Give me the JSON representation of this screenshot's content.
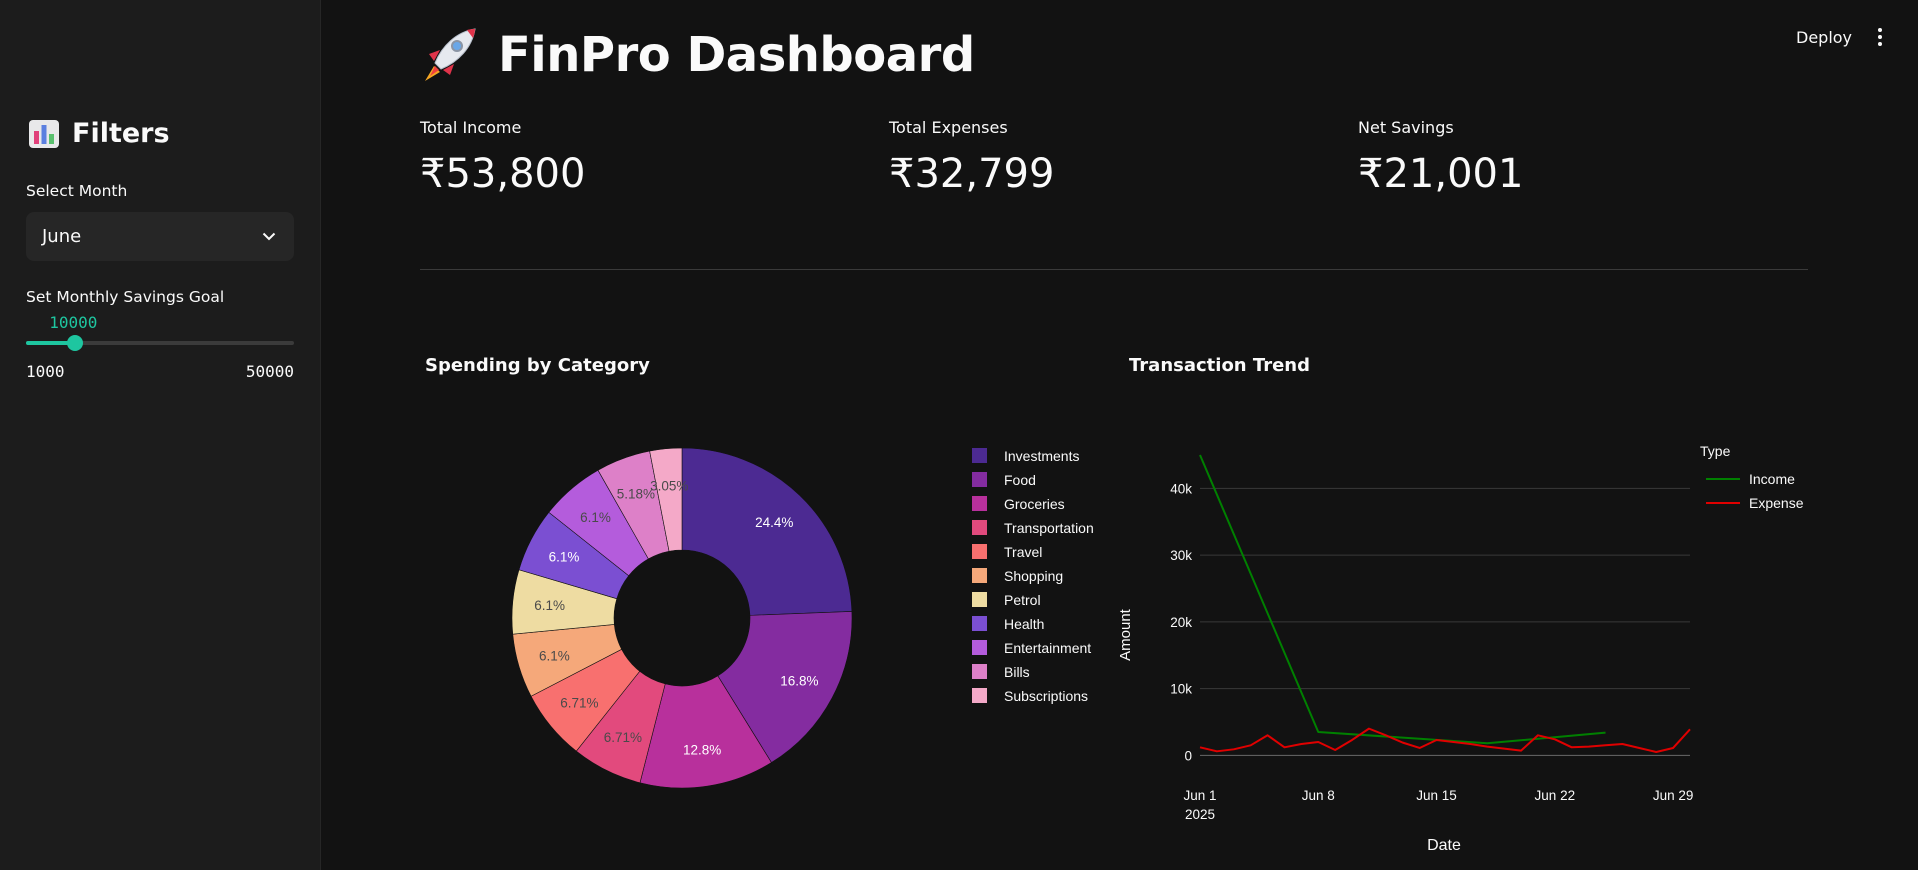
{
  "header": {
    "deploy_label": "Deploy",
    "menu_icon": "kebab-menu-icon"
  },
  "sidebar": {
    "title_icon": "bar-chart-icon",
    "title": "Filters",
    "month_label": "Select Month",
    "month_value": "June",
    "goal_label": "Set Monthly Savings Goal",
    "goal_value": "10000",
    "goal_value_num": 10000,
    "goal_min": "1000",
    "goal_min_num": 1000,
    "goal_max": "50000",
    "goal_max_num": 50000
  },
  "main": {
    "title_icon": "rocket-icon",
    "title": "FinPro Dashboard",
    "metrics": [
      {
        "label": "Total Income",
        "value": "₹53,800"
      },
      {
        "label": "Total Expenses",
        "value": "₹32,799"
      },
      {
        "label": "Net Savings",
        "value": "₹21,001"
      }
    ]
  },
  "colors": {
    "accent": "#1ec6a0",
    "income": "#008000",
    "expense": "#e00000"
  },
  "chart_data": [
    {
      "type": "pie",
      "title": "Spending by Category",
      "hole": true,
      "slices": [
        {
          "label": "Investments",
          "value": 24.4,
          "text": "24.4%",
          "color": "#4c2a92"
        },
        {
          "label": "Food",
          "value": 16.8,
          "text": "16.8%",
          "color": "#842ca0"
        },
        {
          "label": "Groceries",
          "value": 12.8,
          "text": "12.8%",
          "color": "#b8309c"
        },
        {
          "label": "Transportation",
          "value": 6.71,
          "text": "6.71%",
          "color": "#e24a7d"
        },
        {
          "label": "Travel",
          "value": 6.71,
          "text": "6.71%",
          "color": "#f8706f"
        },
        {
          "label": "Shopping",
          "value": 6.1,
          "text": "6.1%",
          "color": "#f5a87a"
        },
        {
          "label": "Petrol",
          "value": 6.1,
          "text": "6.1%",
          "color": "#eedca2"
        },
        {
          "label": "Health",
          "value": 6.1,
          "text": "6.1%",
          "color": "#7b4fd2"
        },
        {
          "label": "Entertainment",
          "value": 6.1,
          "text": "6.1%",
          "color": "#b45cdc"
        },
        {
          "label": "Bills",
          "value": 5.18,
          "text": "5.18%",
          "color": "#dd80c8"
        },
        {
          "label": "Subscriptions",
          "value": 3.05,
          "text": "3.05%",
          "color": "#f4a9c8"
        }
      ]
    },
    {
      "type": "line",
      "title": "Transaction Trend",
      "xlabel": "Date",
      "ylabel": "Amount",
      "legend_title": "Type",
      "legend_position": "top-right",
      "x_range": [
        "2025-06-01",
        "2025-06-30"
      ],
      "ylim": [
        -2200,
        46500
      ],
      "yticks": [
        0,
        10000,
        20000,
        30000,
        40000
      ],
      "ytick_labels": [
        "0",
        "10k",
        "20k",
        "30k",
        "40k"
      ],
      "xticks": [
        "2025-06-01",
        "2025-06-08",
        "2025-06-15",
        "2025-06-22",
        "2025-06-29"
      ],
      "xtick_labels": [
        "Jun 1",
        "Jun 8",
        "Jun 15",
        "Jun 22",
        "Jun 29"
      ],
      "xtick_sublabel": "2025",
      "grid": true,
      "series": [
        {
          "name": "Income",
          "color": "#008000",
          "points": [
            [
              "2025-06-01",
              45000
            ],
            [
              "2025-06-08",
              3500
            ],
            [
              "2025-06-18",
              1800
            ],
            [
              "2025-06-25",
              3400
            ]
          ]
        },
        {
          "name": "Expense",
          "color": "#e00000",
          "points": [
            [
              "2025-06-01",
              1200
            ],
            [
              "2025-06-02",
              600
            ],
            [
              "2025-06-03",
              900
            ],
            [
              "2025-06-04",
              1500
            ],
            [
              "2025-06-05",
              3000
            ],
            [
              "2025-06-06",
              1200
            ],
            [
              "2025-06-07",
              1700
            ],
            [
              "2025-06-08",
              2000
            ],
            [
              "2025-06-09",
              800
            ],
            [
              "2025-06-10",
              2300
            ],
            [
              "2025-06-11",
              4000
            ],
            [
              "2025-06-12",
              3000
            ],
            [
              "2025-06-13",
              1900
            ],
            [
              "2025-06-14",
              1100
            ],
            [
              "2025-06-15",
              2300
            ],
            [
              "2025-06-16",
              2000
            ],
            [
              "2025-06-17",
              1700
            ],
            [
              "2025-06-18",
              1300
            ],
            [
              "2025-06-19",
              1000
            ],
            [
              "2025-06-20",
              700
            ],
            [
              "2025-06-21",
              3000
            ],
            [
              "2025-06-22",
              2400
            ],
            [
              "2025-06-23",
              1200
            ],
            [
              "2025-06-24",
              1300
            ],
            [
              "2025-06-25",
              1500
            ],
            [
              "2025-06-26",
              1700
            ],
            [
              "2025-06-27",
              1100
            ],
            [
              "2025-06-28",
              500
            ],
            [
              "2025-06-29",
              1100
            ],
            [
              "2025-06-30",
              3900
            ]
          ]
        }
      ]
    }
  ]
}
